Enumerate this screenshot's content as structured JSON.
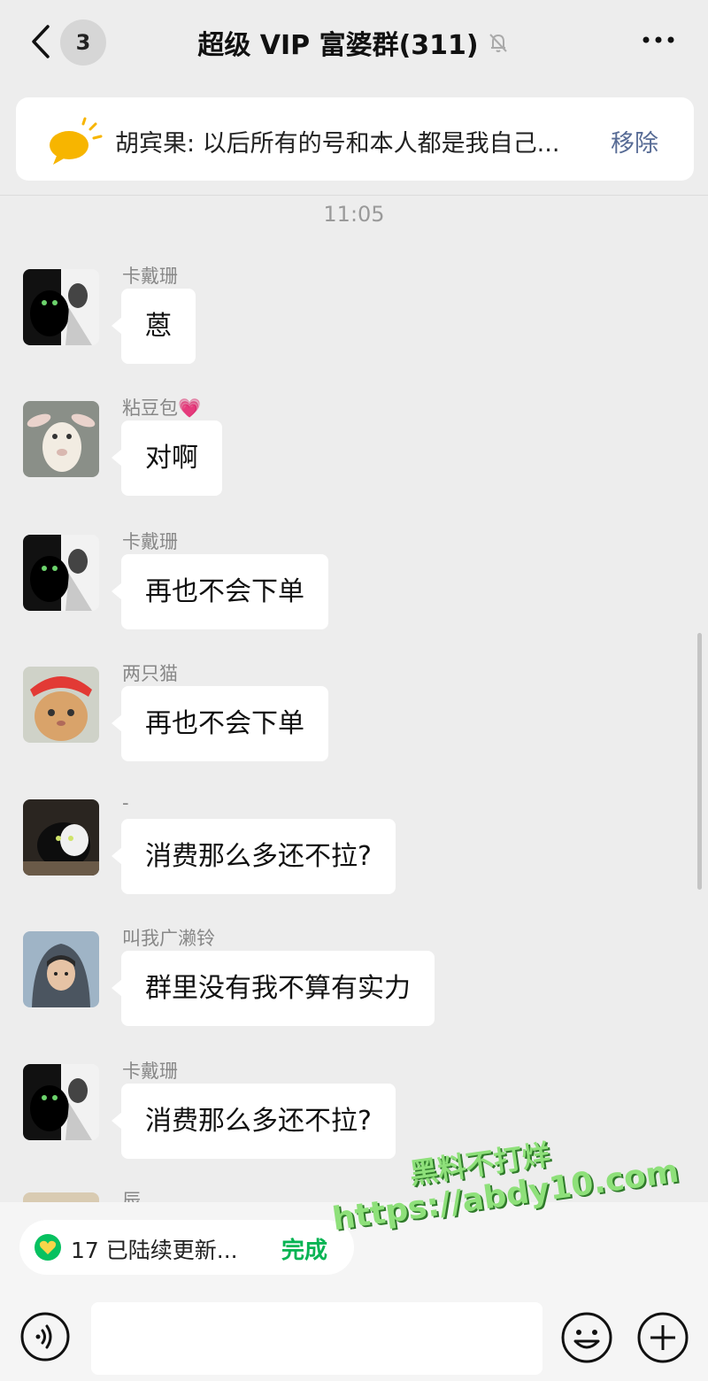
{
  "header": {
    "unread_count": "3",
    "title": "超级 VIP 富婆群(311)"
  },
  "pinned": {
    "text": "胡宾果: 以后所有的号和本人都是我自己...",
    "action": "移除"
  },
  "timestamp": "11:05",
  "messages": [
    {
      "sender": "卡戴珊",
      "text": "蒽",
      "avatar": "black-cat-woman"
    },
    {
      "sender": "粘豆包💗",
      "text": "对啊",
      "avatar": "lamb"
    },
    {
      "sender": "卡戴珊",
      "text": "再也不会下单",
      "avatar": "black-cat-woman"
    },
    {
      "sender": "两只猫",
      "text": "再也不会下单",
      "avatar": "cat-red-hat"
    },
    {
      "sender": "-",
      "text": "消费那么多还不拉?",
      "avatar": "black-white-cat"
    },
    {
      "sender": "叫我广濑铃",
      "text": "群里没有我不算有实力",
      "avatar": "girl-hood"
    },
    {
      "sender": "卡戴珊",
      "text": "消费那么多还不拉?",
      "avatar": "black-cat-woman"
    }
  ],
  "partial_sender": "辰",
  "update_notice": {
    "text": "17 已陆续更新...",
    "action": "完成"
  },
  "watermark": {
    "line1": "黑料不打烊",
    "line2": "https://abdy10.com"
  },
  "colors": {
    "background": "#ededed",
    "link_blue": "#576b95",
    "wechat_green": "#07b453"
  }
}
